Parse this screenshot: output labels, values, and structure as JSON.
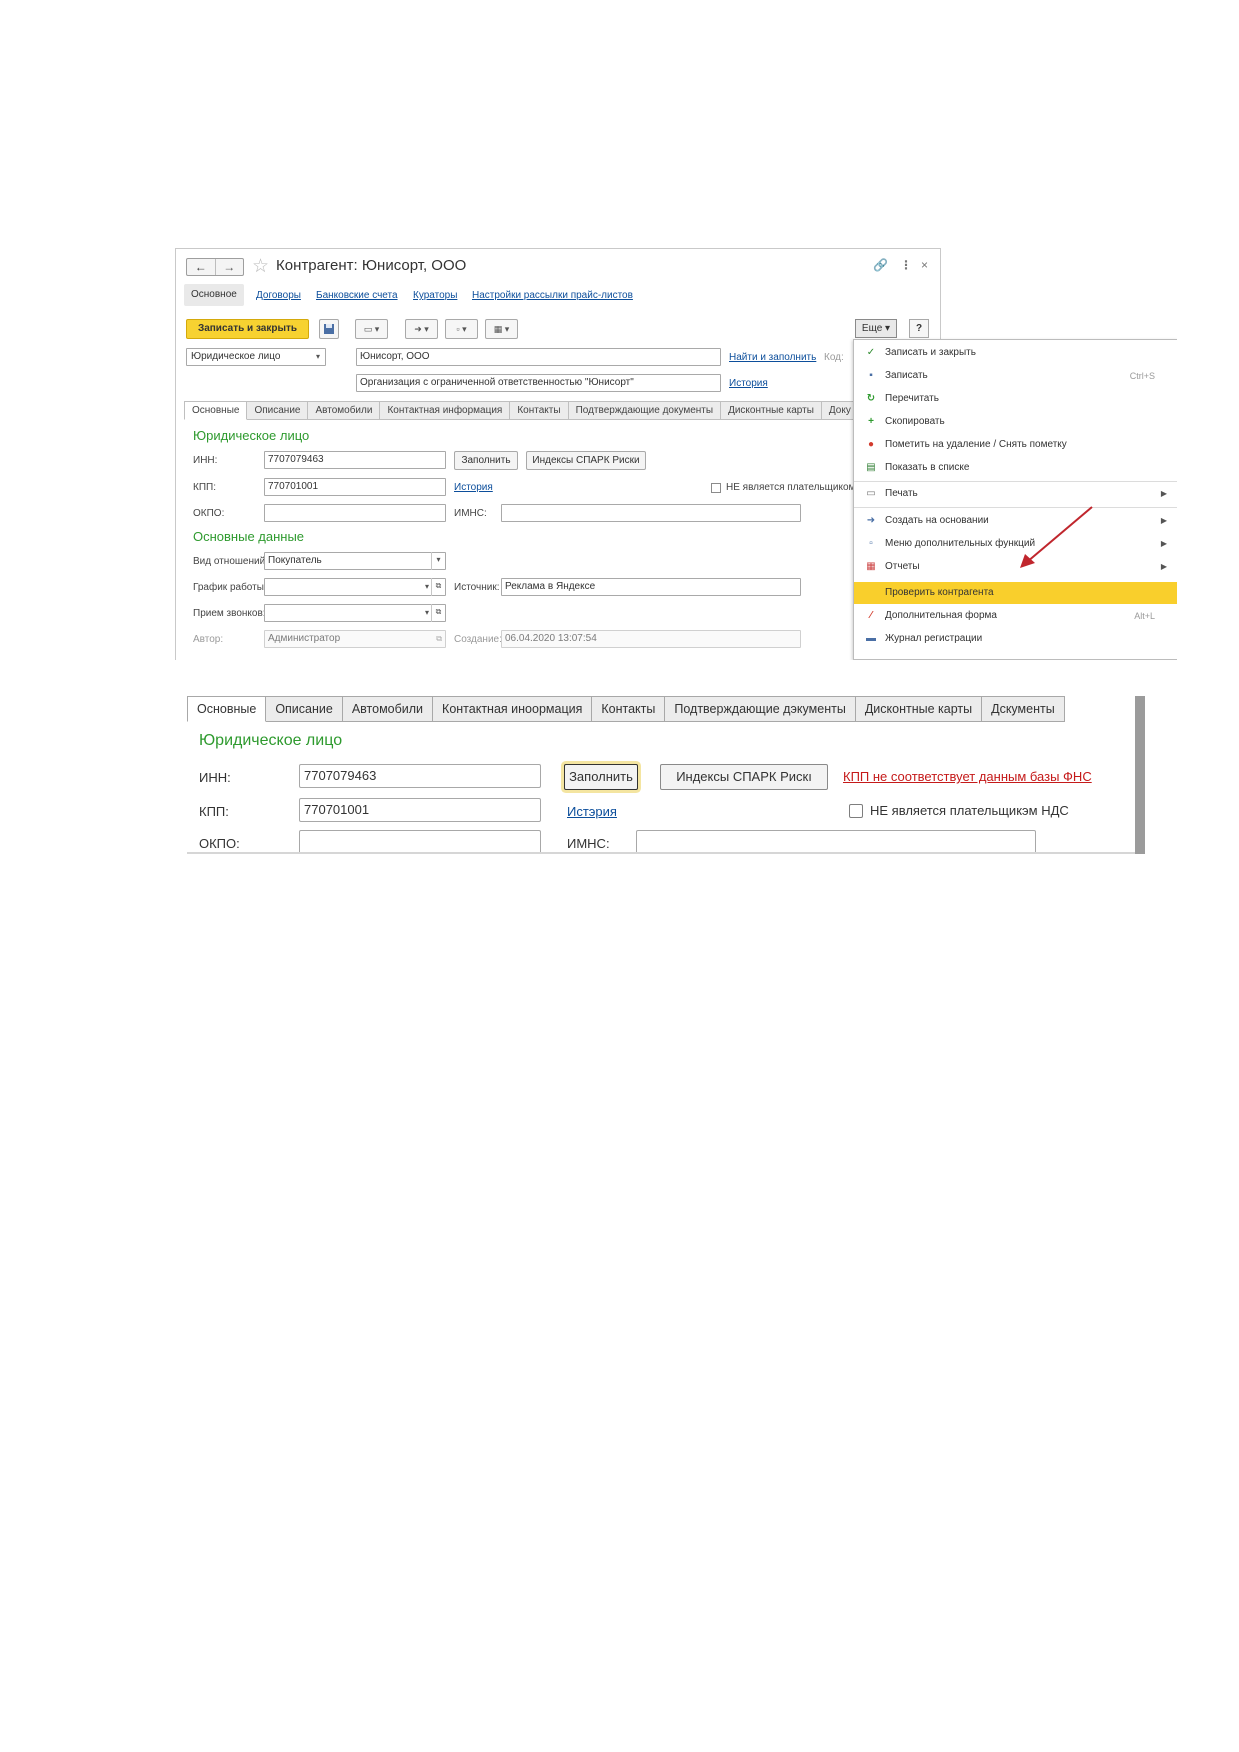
{
  "window": {
    "title": "Контрагент: Юнисорт, ООО",
    "nav_back": "←",
    "nav_forward": "→",
    "link_icon": "🔗",
    "more_icon": "⋮",
    "close_icon": "×"
  },
  "form_tabs": {
    "active": "Основное",
    "links": [
      "Договоры",
      "Банковские счета",
      "Кураторы",
      "Настройки рассылки прайс-листов"
    ]
  },
  "toolbar": {
    "save_close": "Записать и закрыть",
    "more": "Еще",
    "help": "?"
  },
  "header_fields": {
    "legal_type": "Юридическое лицо",
    "name": "Юнисорт, ООО",
    "full_name": "Организация с ограниченной ответственностью \"Юнисорт\"",
    "find_fill": "Найти и заполнить",
    "code_label": "Код:",
    "history": "История"
  },
  "inner_tabs": [
    "Основные",
    "Описание",
    "Автомобили",
    "Контактная информация",
    "Контакты",
    "Подтверждающие документы",
    "Дисконтные карты",
    "Доку"
  ],
  "legal_section": {
    "title": "Юридическое лицо",
    "inn_label": "ИНН:",
    "inn_value": "7707079463",
    "fill_button": "Заполнить",
    "spark_button": "Индексы СПАРК Риски",
    "kpp_label": "КПП:",
    "kpp_value": "770701001",
    "history_link": "История",
    "nds_checkbox": "НЕ является плательщиком",
    "okpo_label": "ОКПО:",
    "imns_label": "ИМНС:"
  },
  "main_section": {
    "title": "Основные данные",
    "relation_label": "Вид отношений:",
    "relation_value": "Покупатель",
    "schedule_label": "График работы:",
    "source_label": "Источник:",
    "source_value": "Реклама в Яндексе",
    "calls_label": "Прием звонков:",
    "author_label": "Автор:",
    "author_value": "Администратор",
    "created_label": "Создание:",
    "created_value": "06.04.2020 13:07:54"
  },
  "menu": {
    "items": [
      {
        "label": "Записать и закрыть",
        "icon": "✓",
        "shortcut": "",
        "arrow": ""
      },
      {
        "label": "Записать",
        "icon": "▪",
        "shortcut": "Ctrl+S",
        "arrow": ""
      },
      {
        "label": "Перечитать",
        "icon": "↻",
        "shortcut": "",
        "arrow": ""
      },
      {
        "label": "Скопировать",
        "icon": "+",
        "shortcut": "",
        "arrow": ""
      },
      {
        "label": "Пометить на удаление / Снять пометку",
        "icon": "●",
        "shortcut": "",
        "arrow": ""
      },
      {
        "label": "Показать в списке",
        "icon": "▤",
        "shortcut": "",
        "arrow": ""
      },
      {
        "label": "Печать",
        "icon": "▭",
        "shortcut": "",
        "arrow": "▶"
      },
      {
        "label": "Создать на основании",
        "icon": "➜",
        "shortcut": "",
        "arrow": "▶"
      },
      {
        "label": "Меню дополнительных функций",
        "icon": "▫",
        "shortcut": "",
        "arrow": "▶"
      },
      {
        "label": "Отчеты",
        "icon": "▦",
        "shortcut": "",
        "arrow": "▶"
      },
      {
        "label": "Проверить контрагента",
        "icon": "",
        "shortcut": "",
        "arrow": ""
      },
      {
        "label": "Дополнительная форма",
        "icon": "⁄",
        "shortcut": "Alt+L",
        "arrow": ""
      },
      {
        "label": "Журнал регистрации",
        "icon": "▬",
        "shortcut": "",
        "arrow": ""
      }
    ]
  },
  "zoom": {
    "tabs": [
      "Основные",
      "Описание",
      "Автомобили",
      "Контактная иноормация",
      "Контакты",
      "Подтверждающие дэкументы",
      "Дисконтные карты",
      "Дскументы"
    ],
    "section_title": "Юридическое лицо",
    "inn_label": "ИНН:",
    "inn_value": "7707079463",
    "fill_button": "Заполнить",
    "spark_button": "Индексы СПАРК Рискı",
    "error_text": "КПП не соответствует данным базы ФНС",
    "kpp_label": "КПП:",
    "kpp_value": "770701001",
    "history_link": "Истэрия",
    "nds_checkbox": "НЕ является плательщикэм НДС",
    "okpo_label": "ОКПО:",
    "imns_label": "ИМНС:"
  },
  "colors": {
    "accent_yellow": "#f7d231",
    "menu_highlight": "#f9cf2c",
    "section_green": "#2e9a2e",
    "link_blue": "#0c4e9b",
    "error_red": "#c51a1a",
    "arrow_red": "#c0262d"
  }
}
